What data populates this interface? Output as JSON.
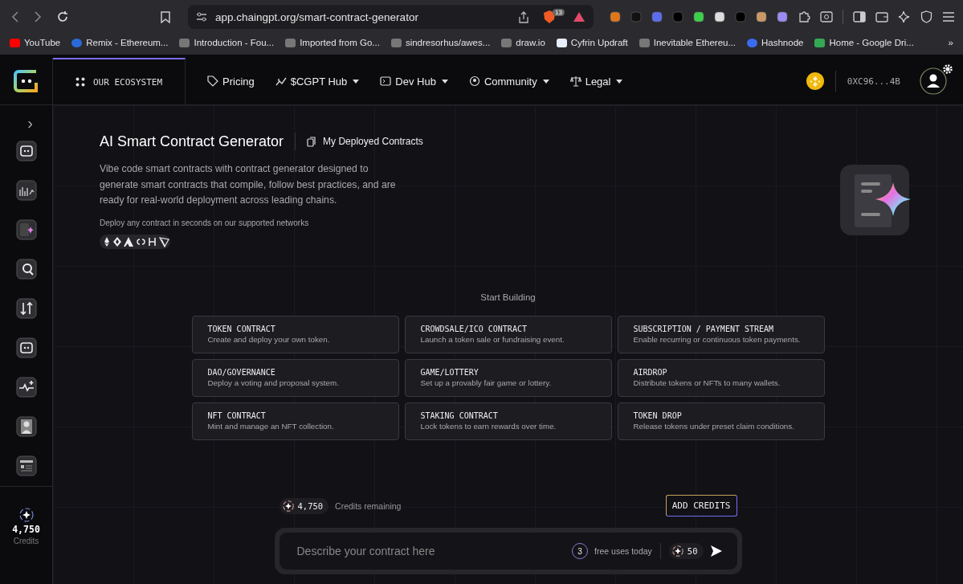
{
  "browser": {
    "url": "app.chaingpt.org/smart-contract-generator",
    "shield_badge": "13",
    "bookmarks": [
      {
        "label": "YouTube"
      },
      {
        "label": "Remix - Ethereum..."
      },
      {
        "label": "Introduction - Fou..."
      },
      {
        "label": "Imported from Go..."
      },
      {
        "label": "sindresorhus/awes..."
      },
      {
        "label": "draw.io"
      },
      {
        "label": "Cyfrin Updraft"
      },
      {
        "label": "Inevitable Ethereu..."
      },
      {
        "label": "Hashnode"
      },
      {
        "label": "Home - Google Dri..."
      }
    ],
    "overflow": "»"
  },
  "header": {
    "ecosystem": "OUR ECOSYSTEM",
    "nav": [
      {
        "label": "Pricing",
        "dropdown": false
      },
      {
        "label": "$CGPT Hub",
        "dropdown": true
      },
      {
        "label": "Dev Hub",
        "dropdown": true
      },
      {
        "label": "Community",
        "dropdown": true
      },
      {
        "label": "Legal",
        "dropdown": true
      }
    ],
    "wallet": "0XC96...4B"
  },
  "sidebar": {
    "expand": "›",
    "credits": "4,750",
    "credits_label": "Credits"
  },
  "main": {
    "title": "AI Smart Contract Generator",
    "deployed_link": "My Deployed Contracts",
    "description": "Vibe code smart contracts with contract generator designed to generate smart contracts that compile, follow best practices, and are ready for real-world deployment across leading chains.",
    "networks_note": "Deploy any contract in seconds on our supported networks",
    "section_title": "Start Building",
    "cards": [
      {
        "title": "TOKEN CONTRACT",
        "description": "Create and deploy your own token."
      },
      {
        "title": "CROWDSALE/ICO CONTRACT",
        "description": "Launch a token sale or fundraising event."
      },
      {
        "title": "SUBSCRIPTION / PAYMENT STREAM",
        "description": "Enable recurring or continuous token payments."
      },
      {
        "title": "DAO/GOVERNANCE",
        "description": "Deploy a voting and proposal system."
      },
      {
        "title": "GAME/LOTTERY",
        "description": "Set up a provably fair game or lottery."
      },
      {
        "title": "AIRDROP",
        "description": "Distribute tokens or NFTs to many wallets."
      },
      {
        "title": "NFT CONTRACT",
        "description": "Mint and manage an NFT collection."
      },
      {
        "title": "STAKING CONTRACT",
        "description": "Lock tokens to earn rewards over time."
      },
      {
        "title": "TOKEN DROP",
        "description": "Release tokens under preset claim conditions."
      }
    ],
    "credits": "4,750",
    "credits_label": "Credits remaining",
    "add_credits": "ADD CREDITS",
    "prompt": {
      "placeholder": "Describe your contract here",
      "free_uses": "3",
      "free_uses_label": "free uses today",
      "cost": "50"
    }
  }
}
